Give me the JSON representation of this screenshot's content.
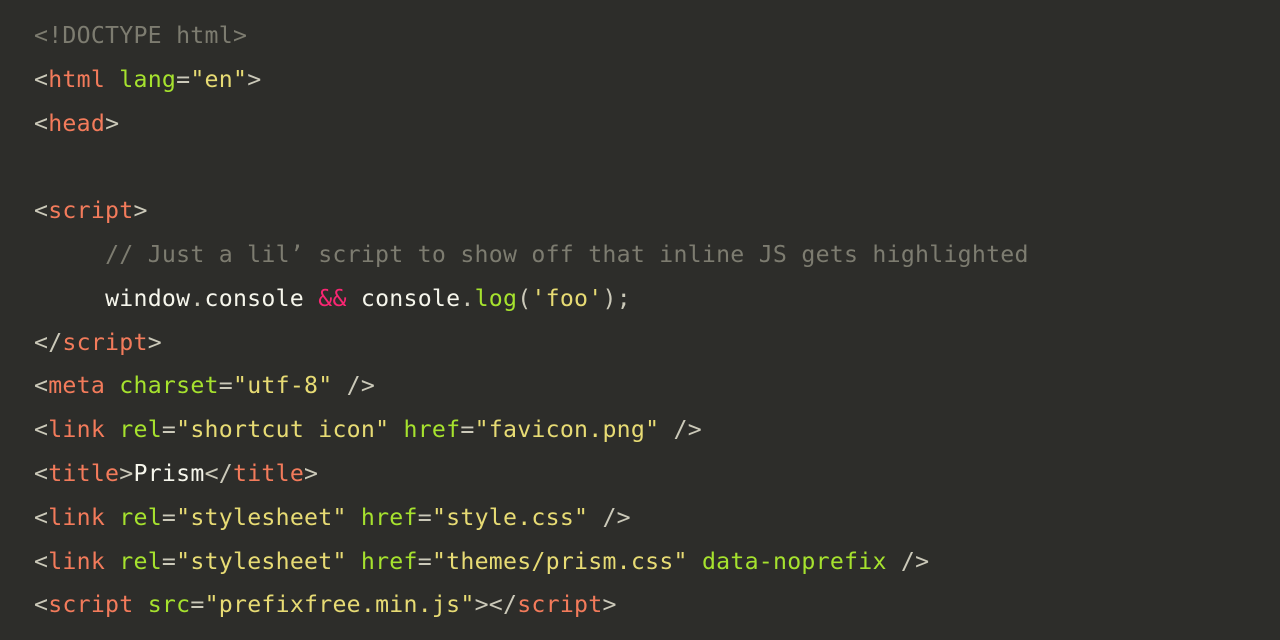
{
  "code": {
    "lines": [
      [
        {
          "cls": "t-doctype",
          "text": "<!DOCTYPE html>"
        }
      ],
      [
        {
          "cls": "t-punct",
          "text": "<"
        },
        {
          "cls": "t-tag",
          "text": "html"
        },
        {
          "cls": "t-punct",
          "text": " "
        },
        {
          "cls": "t-attr",
          "text": "lang"
        },
        {
          "cls": "t-punct",
          "text": "="
        },
        {
          "cls": "t-str",
          "text": "\"en\""
        },
        {
          "cls": "t-punct",
          "text": ">"
        }
      ],
      [
        {
          "cls": "t-punct",
          "text": "<"
        },
        {
          "cls": "t-tag",
          "text": "head"
        },
        {
          "cls": "t-punct",
          "text": ">"
        }
      ],
      [
        {
          "cls": "t-punct",
          "text": ""
        }
      ],
      [
        {
          "cls": "t-punct",
          "text": "<"
        },
        {
          "cls": "t-tag",
          "text": "script"
        },
        {
          "cls": "t-punct",
          "text": ">"
        }
      ],
      [
        {
          "cls": "t-punct",
          "text": "     "
        },
        {
          "cls": "t-comment",
          "text": "// Just a lil’ script to show off that inline JS gets highlighted"
        }
      ],
      [
        {
          "cls": "t-punct",
          "text": "     "
        },
        {
          "cls": "t-ident",
          "text": "window"
        },
        {
          "cls": "t-punct",
          "text": "."
        },
        {
          "cls": "t-ident",
          "text": "console "
        },
        {
          "cls": "t-op",
          "text": "&&"
        },
        {
          "cls": "t-ident",
          "text": " console"
        },
        {
          "cls": "t-punct",
          "text": "."
        },
        {
          "cls": "t-func",
          "text": "log"
        },
        {
          "cls": "t-punct",
          "text": "("
        },
        {
          "cls": "t-str",
          "text": "'foo'"
        },
        {
          "cls": "t-punct",
          "text": ");"
        }
      ],
      [
        {
          "cls": "t-punct",
          "text": "</"
        },
        {
          "cls": "t-tag",
          "text": "script"
        },
        {
          "cls": "t-punct",
          "text": ">"
        }
      ],
      [
        {
          "cls": "t-punct",
          "text": "<"
        },
        {
          "cls": "t-tag",
          "text": "meta"
        },
        {
          "cls": "t-punct",
          "text": " "
        },
        {
          "cls": "t-attr",
          "text": "charset"
        },
        {
          "cls": "t-punct",
          "text": "="
        },
        {
          "cls": "t-str",
          "text": "\"utf-8\""
        },
        {
          "cls": "t-punct",
          "text": " />"
        }
      ],
      [
        {
          "cls": "t-punct",
          "text": "<"
        },
        {
          "cls": "t-tag",
          "text": "link"
        },
        {
          "cls": "t-punct",
          "text": " "
        },
        {
          "cls": "t-attr",
          "text": "rel"
        },
        {
          "cls": "t-punct",
          "text": "="
        },
        {
          "cls": "t-str",
          "text": "\"shortcut icon\""
        },
        {
          "cls": "t-punct",
          "text": " "
        },
        {
          "cls": "t-attr",
          "text": "href"
        },
        {
          "cls": "t-punct",
          "text": "="
        },
        {
          "cls": "t-str",
          "text": "\"favicon.png\""
        },
        {
          "cls": "t-punct",
          "text": " />"
        }
      ],
      [
        {
          "cls": "t-punct",
          "text": "<"
        },
        {
          "cls": "t-tag",
          "text": "title"
        },
        {
          "cls": "t-punct",
          "text": ">"
        },
        {
          "cls": "t-text",
          "text": "Prism"
        },
        {
          "cls": "t-punct",
          "text": "</"
        },
        {
          "cls": "t-tag",
          "text": "title"
        },
        {
          "cls": "t-punct",
          "text": ">"
        }
      ],
      [
        {
          "cls": "t-punct",
          "text": "<"
        },
        {
          "cls": "t-tag",
          "text": "link"
        },
        {
          "cls": "t-punct",
          "text": " "
        },
        {
          "cls": "t-attr",
          "text": "rel"
        },
        {
          "cls": "t-punct",
          "text": "="
        },
        {
          "cls": "t-str",
          "text": "\"stylesheet\""
        },
        {
          "cls": "t-punct",
          "text": " "
        },
        {
          "cls": "t-attr",
          "text": "href"
        },
        {
          "cls": "t-punct",
          "text": "="
        },
        {
          "cls": "t-str",
          "text": "\"style.css\""
        },
        {
          "cls": "t-punct",
          "text": " />"
        }
      ],
      [
        {
          "cls": "t-punct",
          "text": "<"
        },
        {
          "cls": "t-tag",
          "text": "link"
        },
        {
          "cls": "t-punct",
          "text": " "
        },
        {
          "cls": "t-attr",
          "text": "rel"
        },
        {
          "cls": "t-punct",
          "text": "="
        },
        {
          "cls": "t-str",
          "text": "\"stylesheet\""
        },
        {
          "cls": "t-punct",
          "text": " "
        },
        {
          "cls": "t-attr",
          "text": "href"
        },
        {
          "cls": "t-punct",
          "text": "="
        },
        {
          "cls": "t-str",
          "text": "\"themes/prism.css\""
        },
        {
          "cls": "t-punct",
          "text": " "
        },
        {
          "cls": "t-attr",
          "text": "data-noprefix"
        },
        {
          "cls": "t-punct",
          "text": " />"
        }
      ],
      [
        {
          "cls": "t-punct",
          "text": "<"
        },
        {
          "cls": "t-tag",
          "text": "script"
        },
        {
          "cls": "t-punct",
          "text": " "
        },
        {
          "cls": "t-attr",
          "text": "src"
        },
        {
          "cls": "t-punct",
          "text": "="
        },
        {
          "cls": "t-str",
          "text": "\"prefixfree.min.js\""
        },
        {
          "cls": "t-punct",
          "text": "></"
        },
        {
          "cls": "t-tag",
          "text": "script"
        },
        {
          "cls": "t-punct",
          "text": ">"
        }
      ]
    ]
  }
}
